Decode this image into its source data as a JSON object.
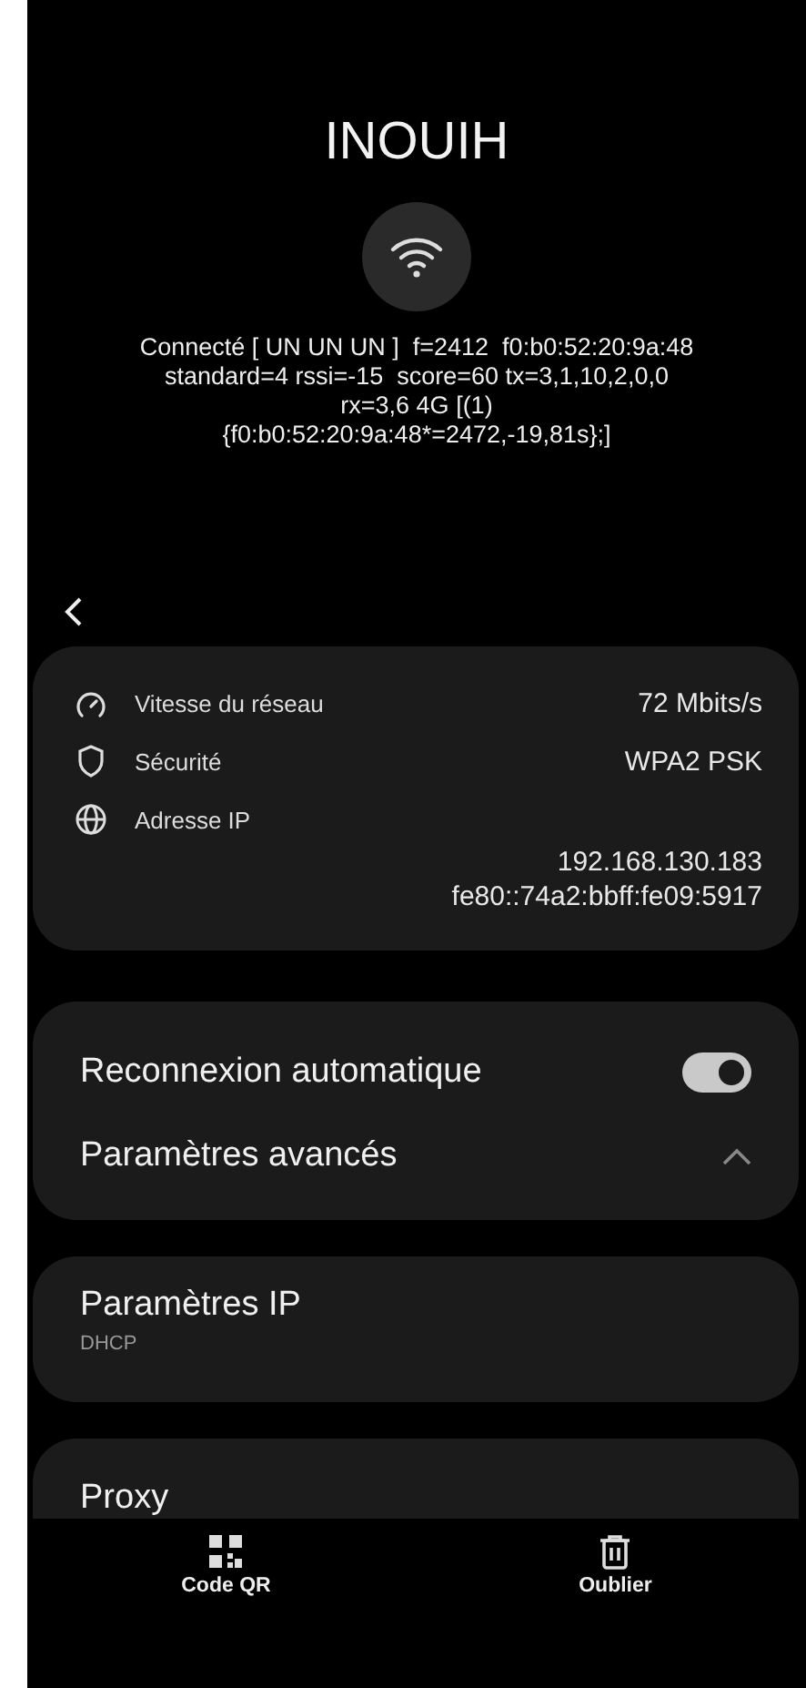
{
  "network_name": "INOUIH",
  "status_lines": [
    "Connecté [ UN UN UN ]  f=2412  f0:b0:52:20:9a:48",
    "standard=4 rssi=-15  score=60 tx=3,1,10,2,0,0",
    "rx=3,6 4G [(1)",
    "{f0:b0:52:20:9a:48*=2472,-19,81s};]"
  ],
  "details": [
    {
      "kind": "speed",
      "label": "Vitesse du réseau",
      "values": [
        "72 Mbits/s"
      ]
    },
    {
      "kind": "security",
      "label": "Sécurité",
      "values": [
        "WPA2 PSK"
      ]
    },
    {
      "kind": "ip",
      "label": "Adresse IP",
      "values": [
        "192.168.130.183",
        "fe80::74a2:bbff:fe09:5917"
      ]
    }
  ],
  "auto_reconnect": {
    "label": "Reconnexion automatique",
    "on": true
  },
  "advanced": {
    "label": "Paramètres avancés",
    "expanded": true
  },
  "ip_settings": {
    "label": "Paramètres IP",
    "value": "DHCP"
  },
  "proxy": {
    "label": "Proxy"
  },
  "actions": [
    {
      "kind": "qr",
      "label": "Code QR"
    },
    {
      "kind": "delete",
      "label": "Oublier"
    }
  ]
}
